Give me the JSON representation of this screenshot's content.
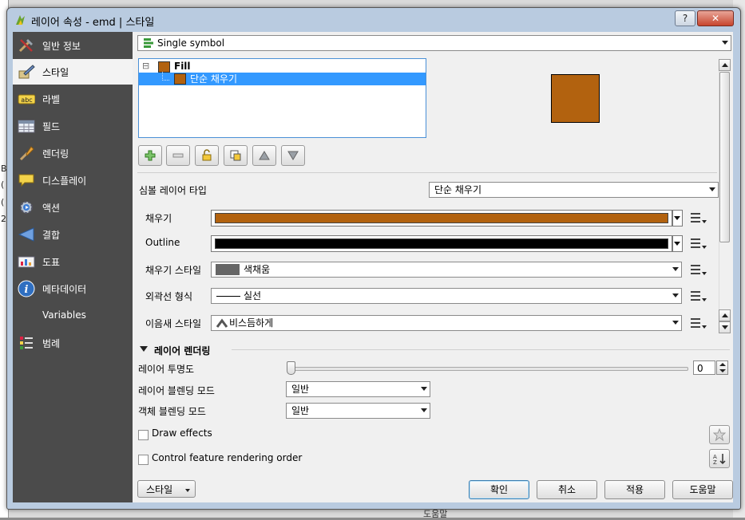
{
  "window": {
    "title": "레이어 속성 - emd | 스타일",
    "help_btn": "?",
    "close_btn": "✕"
  },
  "background": {
    "left_chars": [
      "B",
      "(",
      "(",
      "2"
    ],
    "bottom_text": "도움말"
  },
  "sidebar": {
    "items": [
      {
        "label": "일반 정보",
        "icon": "tools-icon"
      },
      {
        "label": "스타일",
        "icon": "paintbrush-icon",
        "active": true
      },
      {
        "label": "라벨",
        "icon": "abc-label-icon"
      },
      {
        "label": "필드",
        "icon": "table-icon"
      },
      {
        "label": "렌더링",
        "icon": "brush-icon"
      },
      {
        "label": "디스플레이",
        "icon": "speech-bubble-icon"
      },
      {
        "label": "액션",
        "icon": "gear-icon"
      },
      {
        "label": "결합",
        "icon": "join-icon"
      },
      {
        "label": "도표",
        "icon": "diagram-icon"
      },
      {
        "label": "메타데이터",
        "icon": "info-icon"
      },
      {
        "label": "Variables",
        "icon": "variables-icon"
      },
      {
        "label": "범례",
        "icon": "legend-icon"
      }
    ]
  },
  "renderer": {
    "selected": "Single symbol"
  },
  "tree": {
    "root": "Fill",
    "child": "단순 채우기",
    "root_toggle": "⊟"
  },
  "colors": {
    "fill": "#b2620f",
    "outline": "#000000",
    "fill_style_swatch": "#666666",
    "selection": "#3399ff"
  },
  "symbol_layer": {
    "type_label": "심볼 레이어 타입",
    "type_value": "단순 채우기",
    "fill_label": "채우기",
    "outline_label": "Outline",
    "fill_style_label": "채우기 스타일",
    "fill_style_value": "색채움",
    "border_style_label": "외곽선 형식",
    "border_style_value": "실선",
    "join_style_label": "이음새 스타일",
    "join_style_value": "비스듬하게"
  },
  "layer_rendering": {
    "header": "레이어 렌더링",
    "transparency_label": "레이어 투명도",
    "transparency_value": "0",
    "layer_blend_label": "레이어 블렌딩 모드",
    "layer_blend_value": "일반",
    "feature_blend_label": "객체 블렌딩 모드",
    "feature_blend_value": "일반",
    "draw_effects_label": "Draw effects",
    "control_order_label": "Control feature rendering order"
  },
  "footer": {
    "style_btn": "스타일",
    "ok": "확인",
    "cancel": "취소",
    "apply": "적용",
    "help": "도움말"
  }
}
